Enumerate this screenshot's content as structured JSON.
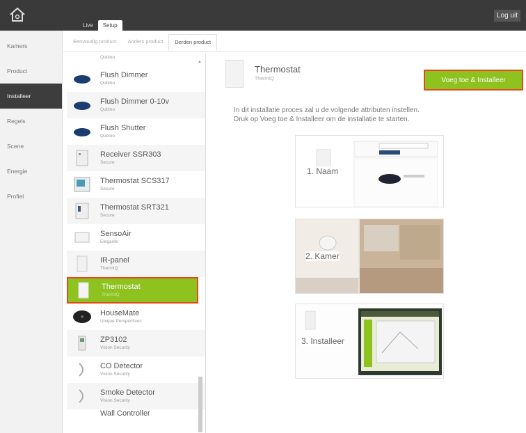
{
  "header": {
    "tabs": [
      {
        "label": "Live",
        "active": false
      },
      {
        "label": "Setup",
        "active": true
      }
    ],
    "logout_label": "Log uit"
  },
  "sidebar": {
    "items": [
      {
        "label": "Kamers",
        "active": false
      },
      {
        "label": "Product",
        "active": false
      },
      {
        "label": "Installeer",
        "active": true
      },
      {
        "label": "Regels",
        "active": false
      },
      {
        "label": "Scene",
        "active": false
      },
      {
        "label": "Energie",
        "active": false
      },
      {
        "label": "Profiel",
        "active": false
      }
    ]
  },
  "subtabs": [
    {
      "label": "Eenvoudig product",
      "active": false
    },
    {
      "label": "Anders product",
      "active": false
    },
    {
      "label": "Derden product",
      "active": true
    }
  ],
  "product_list": {
    "partial_top_brand": "Qubino",
    "items": [
      {
        "name": "Flush Dimmer",
        "brand": "Qubino",
        "icon": "dimmer-module-icon",
        "selected": false
      },
      {
        "name": "Flush Dimmer 0-10v",
        "brand": "Qubino",
        "icon": "dimmer-module-icon",
        "selected": false
      },
      {
        "name": "Flush Shutter",
        "brand": "Qubino",
        "icon": "dimmer-module-icon",
        "selected": false
      },
      {
        "name": "Receiver SSR303",
        "brand": "Secure",
        "icon": "receiver-icon",
        "selected": false
      },
      {
        "name": "Thermostat SCS317",
        "brand": "Secure",
        "icon": "thermostat-screen-icon",
        "selected": false
      },
      {
        "name": "Thermostat SRT321",
        "brand": "Secure",
        "icon": "thermostat-dial-icon",
        "selected": false
      },
      {
        "name": "SensoAir",
        "brand": "Elegante",
        "icon": "sensor-icon",
        "selected": false
      },
      {
        "name": "IR-panel",
        "brand": "ThermIQ",
        "icon": "panel-icon",
        "selected": false
      },
      {
        "name": "Thermostat",
        "brand": "ThermIQ",
        "icon": "panel-icon",
        "selected": true
      },
      {
        "name": "HouseMate",
        "brand": "Unique Perspectives",
        "icon": "housemate-icon",
        "selected": false
      },
      {
        "name": "ZP3102",
        "brand": "Vision Security",
        "icon": "motion-sensor-icon",
        "selected": false
      },
      {
        "name": "CO Detector",
        "brand": "Vision Security",
        "icon": "detector-icon",
        "selected": false
      },
      {
        "name": "Smoke Detector",
        "brand": "Vision Security",
        "icon": "detector-icon",
        "selected": false
      },
      {
        "name": "Wall Controller",
        "brand": "",
        "icon": "wall-controller-icon",
        "selected": false
      }
    ]
  },
  "detail": {
    "title": "Thermostat",
    "brand": "ThermIQ",
    "add_button_label": "Voeg toe & Installeer",
    "description_line1": "In dit installatie proces zal u de volgende attributen instellen.",
    "description_line2": "Druk op Voeg toe & Installeer om de installatie te starten.",
    "steps": [
      {
        "label": "1. Naam"
      },
      {
        "label": "2. Kamer"
      },
      {
        "label": "3. Installeer"
      }
    ]
  },
  "colors": {
    "accent_green": "#8dc21f",
    "highlight_red": "#e34a1b",
    "topbar": "#3a3a3a"
  }
}
